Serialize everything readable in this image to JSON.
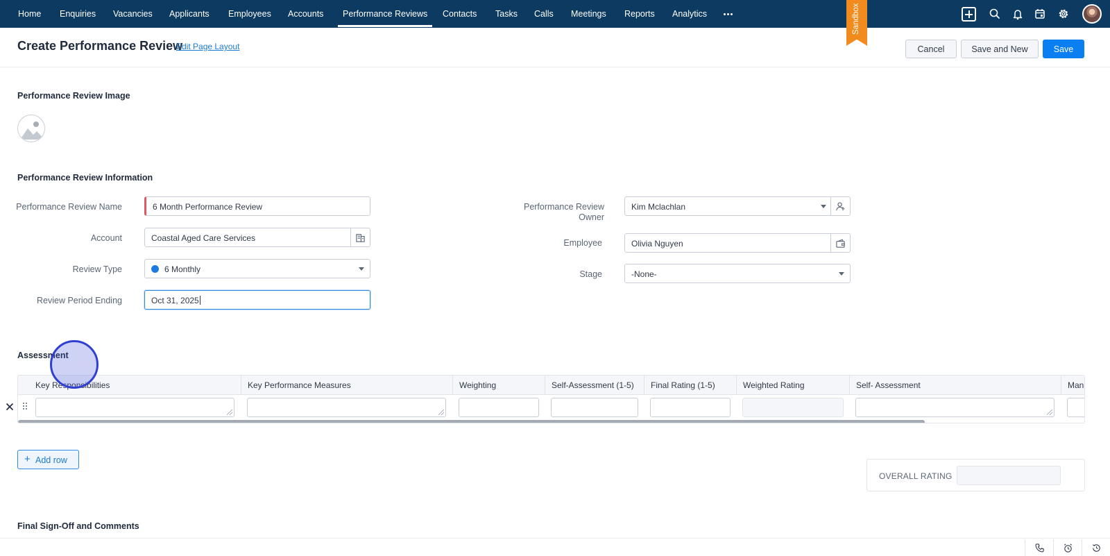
{
  "nav": {
    "items": [
      {
        "label": "Home"
      },
      {
        "label": "Enquiries"
      },
      {
        "label": "Vacancies"
      },
      {
        "label": "Applicants"
      },
      {
        "label": "Employees"
      },
      {
        "label": "Accounts"
      },
      {
        "label": "Performance Reviews",
        "active": true
      },
      {
        "label": "Contacts"
      },
      {
        "label": "Tasks"
      },
      {
        "label": "Calls"
      },
      {
        "label": "Meetings"
      },
      {
        "label": "Reports"
      },
      {
        "label": "Analytics"
      }
    ],
    "more_icon": "more-horizontal-icon",
    "sandbox_label": "Sandbox",
    "icons": [
      "plus-icon",
      "search-icon",
      "bell-icon",
      "calendar-icon",
      "gear-icon",
      "avatar"
    ]
  },
  "header": {
    "title": "Create Performance Review",
    "edit_layout": "Edit Page Layout",
    "cancel": "Cancel",
    "save_and_new": "Save and New",
    "save": "Save"
  },
  "sections": {
    "image": "Performance Review Image",
    "info": "Performance Review Information",
    "assessment": "Assessment",
    "signoff": "Final Sign-Off and Comments"
  },
  "form": {
    "name_label": "Performance Review Name",
    "name_value": "6 Month Performance Review",
    "account_label": "Account",
    "account_value": "Coastal Aged Care Services",
    "review_type_label": "Review Type",
    "review_type_value": "6 Monthly",
    "period_label": "Review Period Ending",
    "period_value": "Oct 31, 2025",
    "owner_label_line1": "Performance Review",
    "owner_label_line2": "Owner",
    "owner_value": "Kim Mclachlan",
    "employee_label": "Employee",
    "employee_value": "Olivia Nguyen",
    "stage_label": "Stage",
    "stage_value": "-None-"
  },
  "assessment": {
    "columns": [
      "Key Responsibilities",
      "Key Performance Measures",
      "Weighting",
      "Self-Assessment (1-5)",
      "Final Rating (1-5)",
      "Weighted Rating",
      "Self- Assessment",
      "Mana"
    ],
    "add_row": "Add row",
    "overall_rating_label": "OVERALL RATING"
  },
  "colors": {
    "nav_bg": "#0c3a60",
    "primary": "#0a7ff1",
    "sandbox": "#f18b1d",
    "mandatory": "#e25563"
  }
}
